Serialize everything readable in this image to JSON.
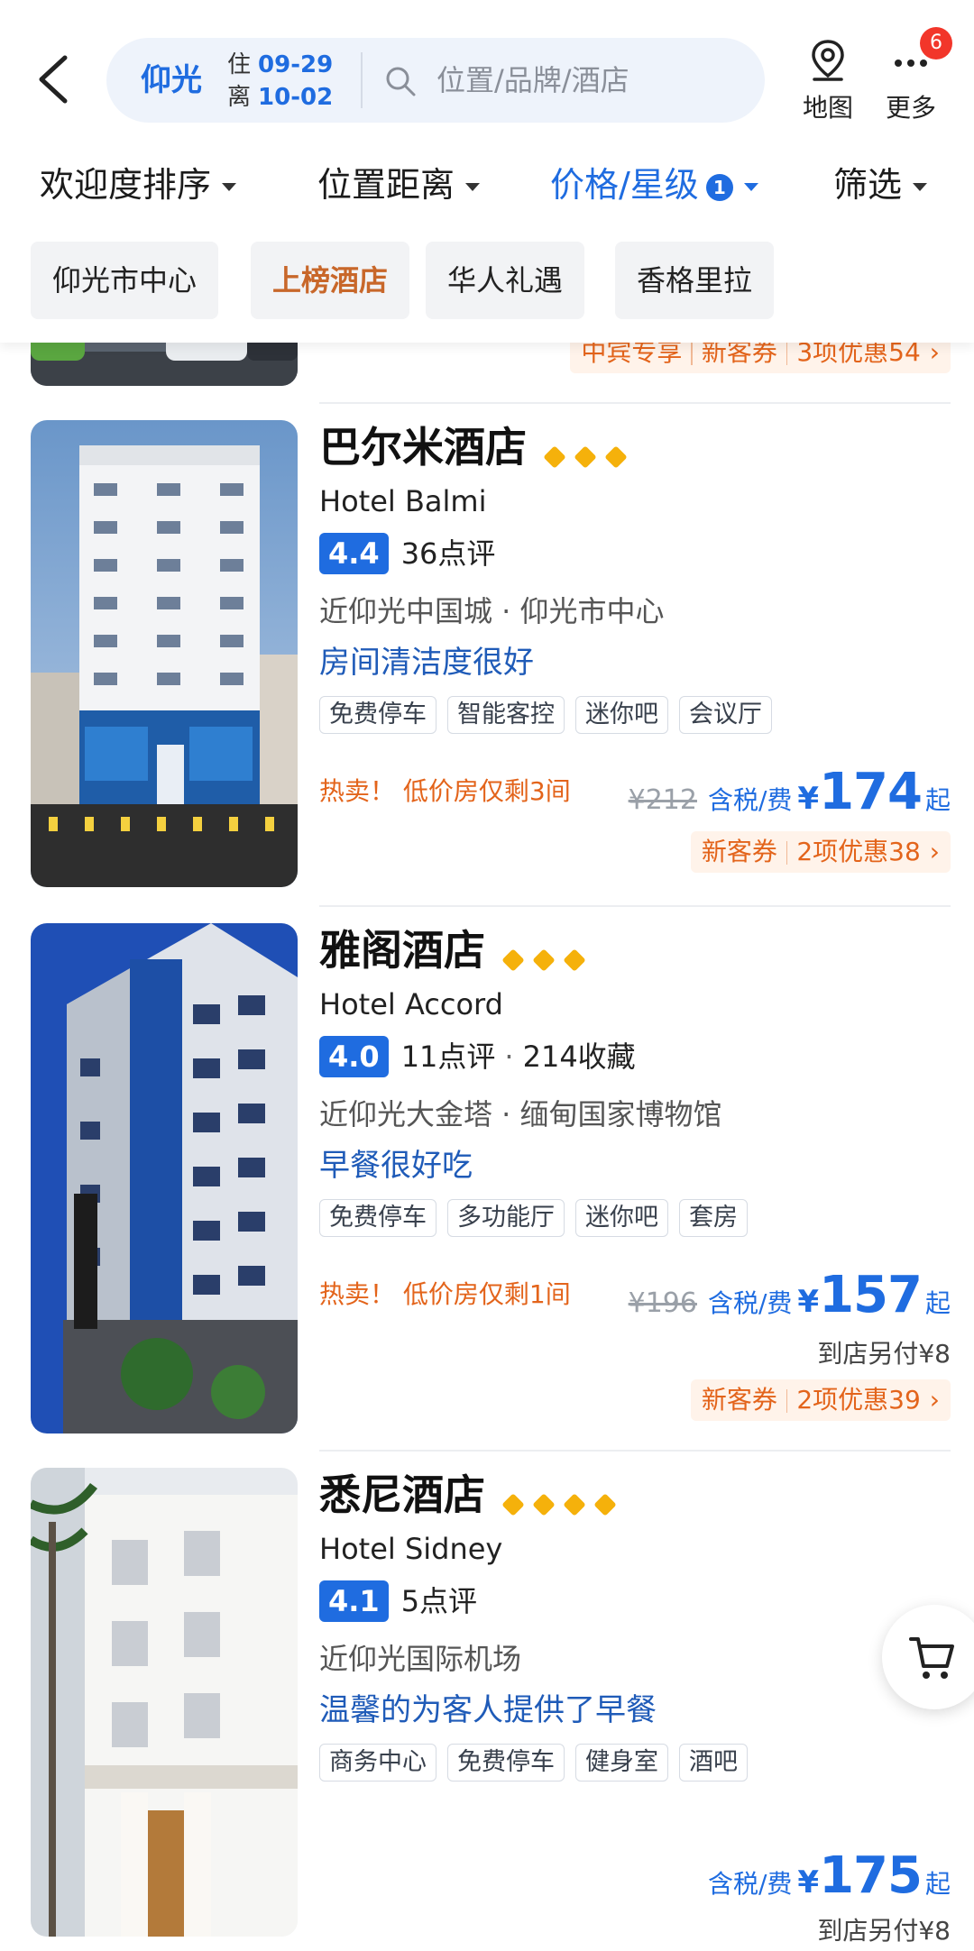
{
  "header": {
    "city": "仰光",
    "checkin_label": "住",
    "checkin_date": "09-29",
    "checkout_label": "离",
    "checkout_date": "10-02",
    "search_placeholder": "位置/品牌/酒店",
    "map_label": "地图",
    "more_label": "更多",
    "more_badge": "6"
  },
  "sort_bar": {
    "popularity": "欢迎度排序",
    "distance": "位置距离",
    "price_star": "价格/星级",
    "price_star_count": "1",
    "filter": "筛选"
  },
  "quick_filters": [
    "仰光市中心",
    "上榜酒店",
    "华人礼遇",
    "香格里拉"
  ],
  "partial_card": {
    "promo_a": "中宾专享",
    "promo_b": "新客券",
    "promo_c": "3项优惠54",
    "arrow": "›"
  },
  "hotels": [
    {
      "name": "巴尔米酒店",
      "stars": 3,
      "en_name": "Hotel Balmi",
      "score": "4.4",
      "reviews": "36点评",
      "favorites": "",
      "location": "近仰光中国城 · 仰光市中心",
      "highlight": "房间清洁度很好",
      "tags": [
        "免费停车",
        "智能客控",
        "迷你吧",
        "会议厅"
      ],
      "hot": "热卖！ 低价房仅剩3间",
      "orig_price": "¥212",
      "tax_label": "含税/费",
      "currency": "¥",
      "price": "174",
      "price_suffix": "起",
      "extra_fee": "",
      "promo_a": "新客券",
      "promo_b": "2项优惠38",
      "arrow": "›"
    },
    {
      "name": "雅阁酒店",
      "stars": 3,
      "en_name": "Hotel Accord",
      "score": "4.0",
      "reviews": "11点评",
      "favorites": "214收藏",
      "location": "近仰光大金塔 · 缅甸国家博物馆",
      "highlight": "早餐很好吃",
      "tags": [
        "免费停车",
        "多功能厅",
        "迷你吧",
        "套房"
      ],
      "hot": "热卖！ 低价房仅剩1间",
      "orig_price": "¥196",
      "tax_label": "含税/费",
      "currency": "¥",
      "price": "157",
      "price_suffix": "起",
      "extra_fee": "到店另付¥8",
      "promo_a": "新客券",
      "promo_b": "2项优惠39",
      "arrow": "›"
    },
    {
      "name": "悉尼酒店",
      "stars": 4,
      "en_name": "Hotel Sidney",
      "score": "4.1",
      "reviews": "5点评",
      "favorites": "",
      "location": "近仰光国际机场",
      "highlight": "温馨的为客人提供了早餐",
      "tags": [
        "商务中心",
        "免费停车",
        "健身室",
        "酒吧"
      ],
      "hot": "",
      "orig_price": "",
      "tax_label": "含税/费",
      "currency": "¥",
      "price": "175",
      "price_suffix": "起",
      "extra_fee": "到店另付¥8",
      "promo_a": "",
      "promo_b": "",
      "arrow": ""
    }
  ],
  "colors": {
    "accent_blue": "#1f6ce0",
    "promo_orange": "#e3641b",
    "star_gold": "#f5b10b",
    "badge_red": "#f2362a"
  },
  "icons": [
    "back-arrow-icon",
    "search-icon",
    "map-pin-icon",
    "more-dots-icon",
    "shopping-cart-icon",
    "diamond-star-icon"
  ]
}
